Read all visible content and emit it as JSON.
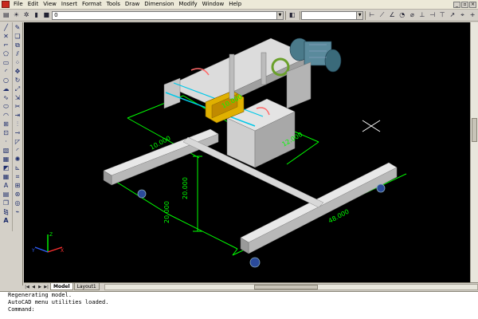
{
  "menu": {
    "items": [
      "File",
      "Edit",
      "View",
      "Insert",
      "Format",
      "Tools",
      "Draw",
      "Dimension",
      "Modify",
      "Window",
      "Help"
    ]
  },
  "toolbar": {
    "layer_value": "0",
    "style_value": ""
  },
  "dimensions": {
    "d1": "10.000",
    "d2": "12.000",
    "d3": "20.000",
    "d4": "20.000",
    "d5": "48.000",
    "d6": "10.000"
  },
  "tabs": {
    "model": "Model",
    "layout1": "Layout1"
  },
  "command": {
    "line1": "Regenerating model.",
    "line2": "AutoCAD menu utilities loaded.",
    "prompt": "Command:"
  },
  "ucs": {
    "x": "X",
    "y": "Y",
    "z": "Z"
  },
  "colors": {
    "canvas": "#000000",
    "dimension": "#00ff00",
    "frame": "#dcdcdc",
    "accent_yellow": "#e0b000",
    "accent_cyan": "#00c8e8",
    "motor": "#5a7a8c"
  },
  "icons": [
    "app-icon",
    "line-icon",
    "circle-icon",
    "arc-icon",
    "rectangle-icon",
    "polygon-icon",
    "hatch-icon",
    "text-icon",
    "erase-icon",
    "copy-icon",
    "move-icon",
    "rotate-icon",
    "crosshair-icon"
  ]
}
